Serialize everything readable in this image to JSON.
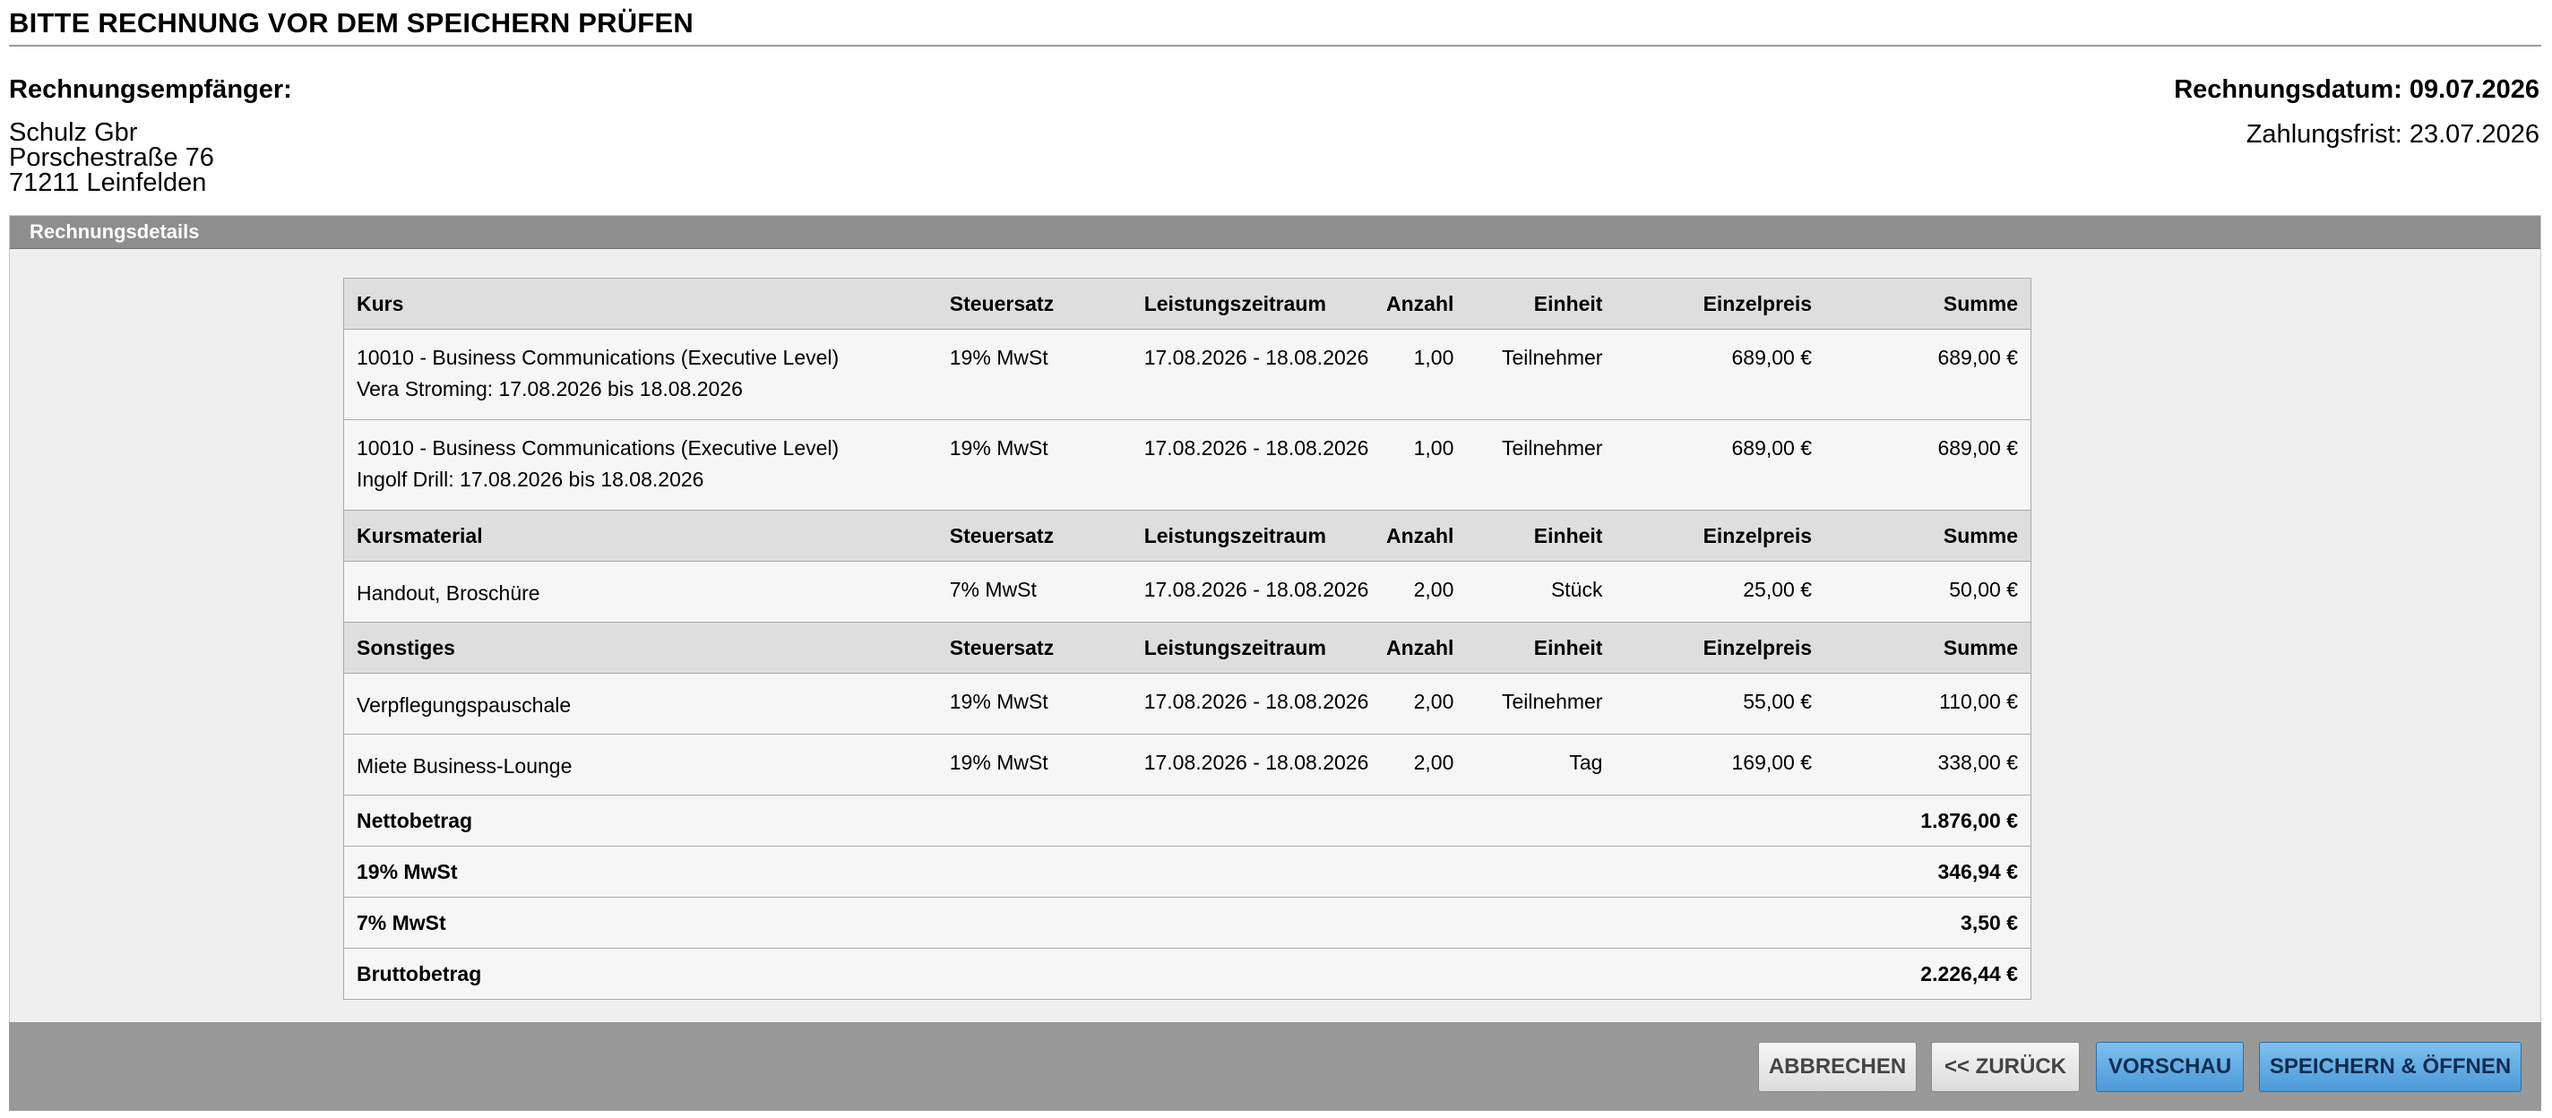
{
  "page": {
    "title": "BITTE RECHNUNG VOR DEM SPEICHERN PRÜFEN"
  },
  "recipient": {
    "label": "Rechnungsempfänger:",
    "name": "Schulz Gbr",
    "street": "Porschestraße 76",
    "city": "71211 Leinfelden"
  },
  "dates": {
    "invoice_date": "Rechnungsdatum: 09.07.2026",
    "due_date": "Zahlungsfrist: 23.07.2026"
  },
  "panel": {
    "title": "Rechnungsdetails"
  },
  "sections": {
    "kurs": {
      "header": [
        "Kurs",
        "Steuersatz",
        "Leistungszeitraum",
        "Anzahl",
        "Einheit",
        "Einzelpreis",
        "Summe"
      ],
      "rows": [
        {
          "title": "10010 - Business Communications (Executive Level)",
          "detail": "Vera Stroming: 17.08.2026 bis 18.08.2026",
          "tax": "19% MwSt",
          "period": "17.08.2026 - 18.08.2026",
          "qty": "1,00",
          "unit": "Teilnehmer",
          "price": "689,00 €",
          "sum": "689,00 €"
        },
        {
          "title": "10010 - Business Communications (Executive Level)",
          "detail": "Ingolf Drill: 17.08.2026 bis 18.08.2026",
          "tax": "19% MwSt",
          "period": "17.08.2026 - 18.08.2026",
          "qty": "1,00",
          "unit": "Teilnehmer",
          "price": "689,00 €",
          "sum": "689,00 €"
        }
      ]
    },
    "material": {
      "header": [
        "Kursmaterial",
        "Steuersatz",
        "Leistungszeitraum",
        "Anzahl",
        "Einheit",
        "Einzelpreis",
        "Summe"
      ],
      "rows": [
        {
          "title": "Handout, Broschüre",
          "tax": "7% MwSt",
          "period": "17.08.2026 - 18.08.2026",
          "qty": "2,00",
          "unit": "Stück",
          "price": "25,00 €",
          "sum": "50,00 €"
        }
      ]
    },
    "other": {
      "header": [
        "Sonstiges",
        "Steuersatz",
        "Leistungszeitraum",
        "Anzahl",
        "Einheit",
        "Einzelpreis",
        "Summe"
      ],
      "rows": [
        {
          "title": "Verpflegungspauschale",
          "tax": "19% MwSt",
          "period": "17.08.2026 - 18.08.2026",
          "qty": "2,00",
          "unit": "Teilnehmer",
          "price": "55,00 €",
          "sum": "110,00 €"
        },
        {
          "title": "Miete Business-Lounge",
          "tax": "19% MwSt",
          "period": "17.08.2026 - 18.08.2026",
          "qty": "2,00",
          "unit": "Tag",
          "price": "169,00 €",
          "sum": "338,00 €"
        }
      ]
    }
  },
  "totals": [
    {
      "label": "Nettobetrag",
      "value": "1.876,00 €"
    },
    {
      "label": "19% MwSt",
      "value": "346,94 €"
    },
    {
      "label": "7% MwSt",
      "value": "3,50 €"
    },
    {
      "label": "Bruttobetrag",
      "value": "2.226,44 €"
    }
  ],
  "buttons": {
    "cancel": "ABBRECHEN",
    "back": "<< ZURÜCK",
    "preview": "VORSCHAU",
    "save_open": "SPEICHERN & ÖFFNEN"
  }
}
